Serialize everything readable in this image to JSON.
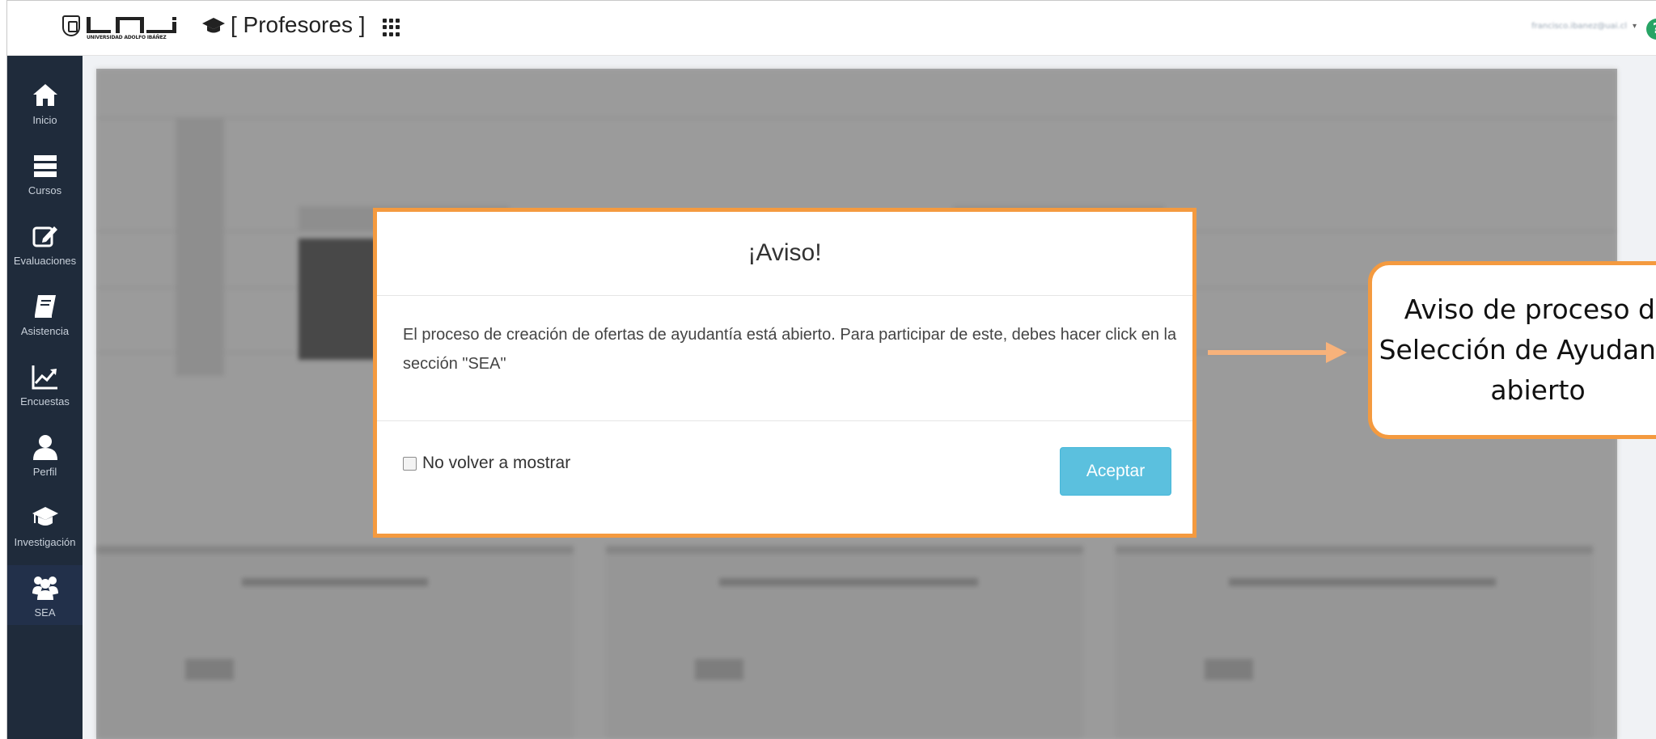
{
  "header": {
    "logo_text": "UNIVERSIDAD ADOLFO IBÁÑEZ",
    "app_title": "[ Profesores ]",
    "user_label": "francisco.ibanez@uai.cl"
  },
  "sidebar": {
    "items": [
      {
        "label": "Inicio",
        "icon": "home-icon"
      },
      {
        "label": "Cursos",
        "icon": "courses-icon"
      },
      {
        "label": "Evaluaciones",
        "icon": "edit-icon"
      },
      {
        "label": "Asistencia",
        "icon": "book-icon"
      },
      {
        "label": "Encuestas",
        "icon": "chart-icon"
      },
      {
        "label": "Perfil",
        "icon": "user-icon"
      },
      {
        "label": "Investigación",
        "icon": "graduation-cap-icon"
      },
      {
        "label": "SEA",
        "icon": "users-icon"
      }
    ]
  },
  "modal": {
    "title": "¡Aviso!",
    "body": "El proceso de creación de ofertas de ayudantía está abierto. Para participar de este, debes hacer click en la sección \"SEA\"",
    "checkbox_label": "No volver a mostrar",
    "button_label": "Aceptar"
  },
  "callout": {
    "lines": [
      "Aviso de proceso de",
      "Selección de Ayudantes",
      "abierto"
    ]
  },
  "colors": {
    "sidebar_bg": "#1f2b3b",
    "accent_orange": "#f49a3f",
    "button_info": "#5bc0de",
    "help_green": "#27a465"
  }
}
